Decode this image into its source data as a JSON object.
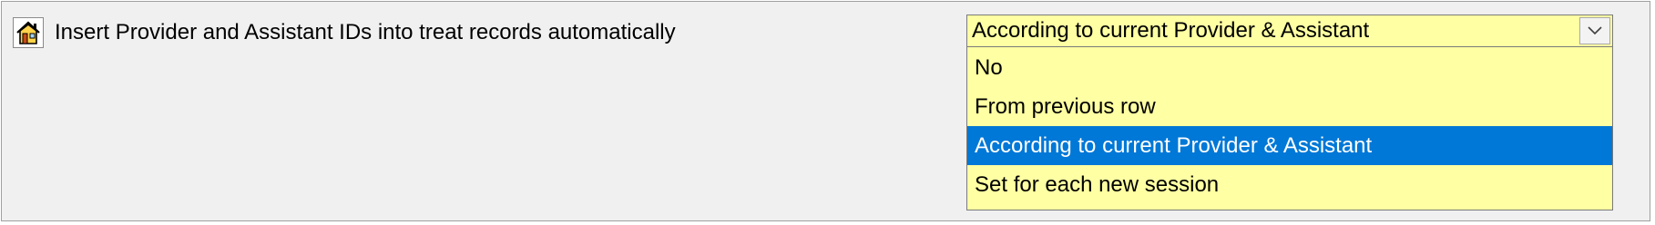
{
  "setting": {
    "icon": "home-icon",
    "label": "Insert Provider and Assistant IDs into treat records automatically"
  },
  "combo": {
    "selected_value": "According to current Provider & Assistant",
    "arrow_icon": "chevron-down-icon",
    "background_color": "#ffffa3",
    "highlight_color": "#0078d7",
    "options": [
      {
        "label": "No",
        "selected": false
      },
      {
        "label": "From previous row",
        "selected": false
      },
      {
        "label": "According to current Provider & Assistant",
        "selected": true
      },
      {
        "label": "Set for each new session",
        "selected": false
      }
    ]
  }
}
